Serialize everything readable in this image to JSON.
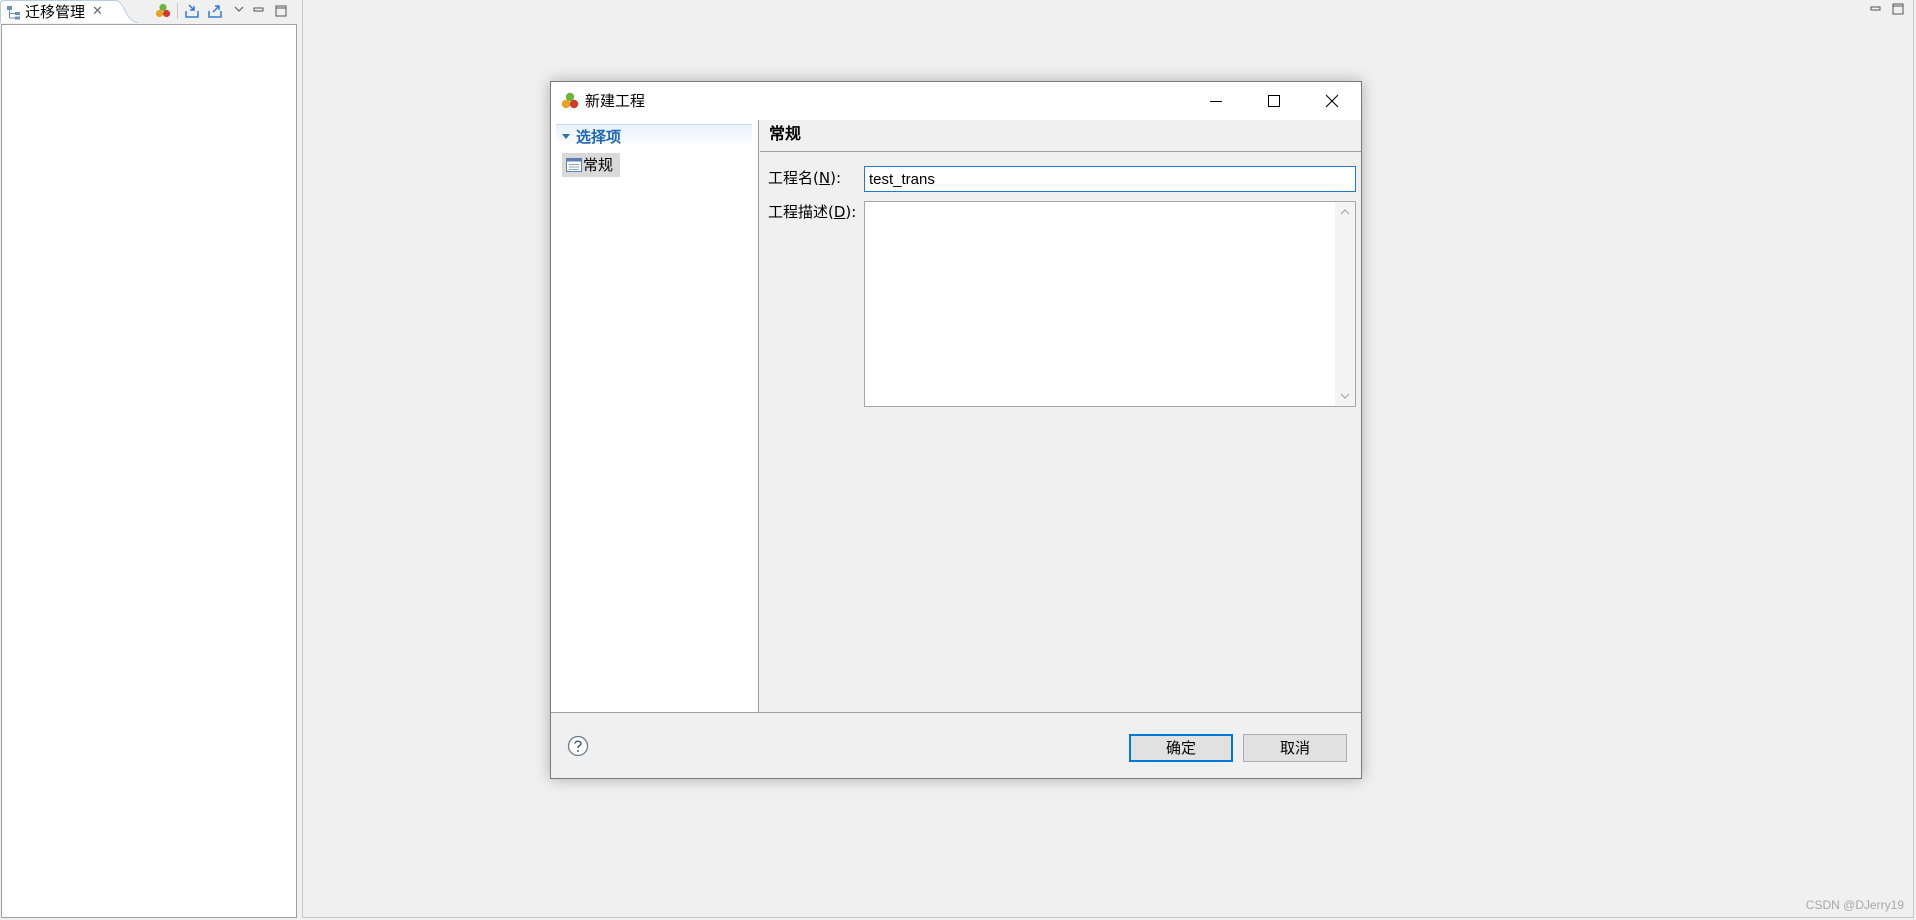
{
  "view": {
    "tab_title": "迁移管理",
    "close_symbol": "✕",
    "toolbar_icons": [
      "project-icon",
      "import-icon",
      "export-icon",
      "view-menu-icon",
      "minimize-icon",
      "maximize-icon"
    ]
  },
  "editor": {
    "buttons": [
      "minimize-icon",
      "maximize-icon"
    ]
  },
  "dialog": {
    "title": "新建工程",
    "caption_buttons": [
      "minimize",
      "maximize",
      "close"
    ],
    "nav": {
      "section_title": "选择项",
      "items": [
        {
          "label": "常规",
          "selected": true
        }
      ]
    },
    "page": {
      "title": "常规",
      "name_label_prefix": "工程名(",
      "name_label_mnemonic": "N",
      "name_label_suffix": "):",
      "name_value": "test_trans",
      "desc_label_prefix": "工程描述(",
      "desc_label_mnemonic": "D",
      "desc_label_suffix": "):",
      "desc_value": ""
    },
    "footer": {
      "ok_label": "确定",
      "cancel_label": "取消",
      "help_icon": "help-icon"
    }
  },
  "watermark": "CSDN @DJerry19",
  "colors": {
    "accent": "#0078d7",
    "section_title": "#1f66b9",
    "background": "#f0f0f0"
  }
}
